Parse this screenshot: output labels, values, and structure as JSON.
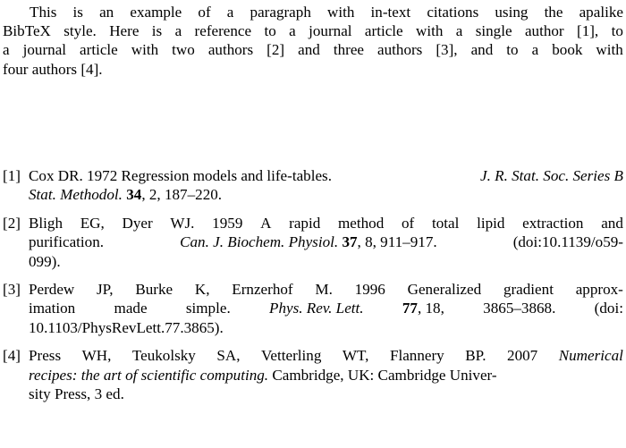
{
  "document": {
    "type": "latex-bibliography-example",
    "background_color": "#ffffff",
    "text_color": "#000000",
    "intro": {
      "lines": [
        "This is an example of a paragraph with in-text citations using the apalike",
        "BibTeX style. Here is a reference to a journal article with a single author [1], to",
        "a journal article with two authors [2] and three authors [3], and to a book with",
        "four authors [4]."
      ],
      "full_text": "This is an example of a paragraph with in-text citations using the apalike BibTeX style. Here is a reference to a journal article with a single author [1], to a journal article with two authors [2] and three authors [3], and to a book with four authors [4]."
    },
    "references": [
      {
        "label": "[1]",
        "authors": "Cox DR.",
        "year": "1972",
        "title": "Regression models and life-tables.",
        "journal": "J. R. Stat. Soc. Series B Stat. Methodol.",
        "volume": "34",
        "issue": "2",
        "pages": "187–220",
        "line1_a": "Cox DR. 1972 Regression models and life-tables.",
        "line1_b": "J. R. Stat. Soc. Series B",
        "line2_a": "Stat. Methodol.",
        "line2_b": "34",
        "line2_c": ", 2, 187–220."
      },
      {
        "label": "[2]",
        "authors": "Bligh EG, Dyer WJ.",
        "year": "1959",
        "title": "A rapid method of total lipid extraction and purification.",
        "journal": "Can. J. Biochem. Physiol.",
        "volume": "37",
        "issue": "8",
        "pages": "911–917",
        "doi": "doi:10.1139/o59-099",
        "line1_w1": "Bligh",
        "line1_w2": "EG,",
        "line1_w3": "Dyer",
        "line1_w4": "WJ.",
        "line1_w5": "1959",
        "line1_w6": "A",
        "line1_w7": "rapid",
        "line1_w8": "method",
        "line1_w9": "of",
        "line1_w10": "total",
        "line1_w11": "lipid",
        "line1_w12": "extraction",
        "line1_w13": "and",
        "line2_a": "purification.",
        "line2_b": "Can. J. Biochem. Physiol.",
        "line2_c": "37",
        "line2_d": ", 8, 911–917.",
        "line2_e": "(doi:10.1139/o59-",
        "line3": "099)."
      },
      {
        "label": "[3]",
        "authors": "Perdew JP, Burke K, Ernzerhof M.",
        "year": "1996",
        "title": "Generalized gradient approximation made simple.",
        "journal": "Phys. Rev. Lett.",
        "volume": "77",
        "issue": "18",
        "pages": "3865–3868",
        "doi": "doi: 10.1103/PhysRevLett.77.3865",
        "line1_w1": "Perdew",
        "line1_w2": "JP,",
        "line1_w3": "Burke",
        "line1_w4": "K,",
        "line1_w5": "Ernzerhof",
        "line1_w6": "M.",
        "line1_w7": "1996",
        "line1_w8": "Generalized",
        "line1_w9": "gradient",
        "line1_w10": "approx-",
        "line2_w1": "imation",
        "line2_w2": "made",
        "line2_w3": "simple.",
        "line2_w4": "Phys. Rev. Lett.",
        "line2_w5": "77",
        "line2_w6": ", 18,",
        "line2_w7": "3865–3868.",
        "line2_w8": "(doi:",
        "line3": "10.1103/PhysRevLett.77.3865)."
      },
      {
        "label": "[4]",
        "authors": "Press WH, Teukolsky SA, Vetterling WT, Flannery BP.",
        "year": "2007",
        "title": "Numerical recipes: the art of scientific computing.",
        "publisher_place": "Cambridge, UK: Cambridge University Press",
        "edition": "3 ed.",
        "line1_w1": "Press",
        "line1_w2": "WH,",
        "line1_w3": "Teukolsky",
        "line1_w4": "SA,",
        "line1_w5": "Vetterling",
        "line1_w6": "WT,",
        "line1_w7": "Flannery",
        "line1_w8": "BP.",
        "line1_w9": "2007",
        "line1_w10": "Numerical",
        "line2_a": "recipes: the art of scientific computing.",
        "line2_b": "Cambridge, UK: Cambridge Univer-",
        "line3": "sity Press, 3 ed."
      }
    ]
  }
}
